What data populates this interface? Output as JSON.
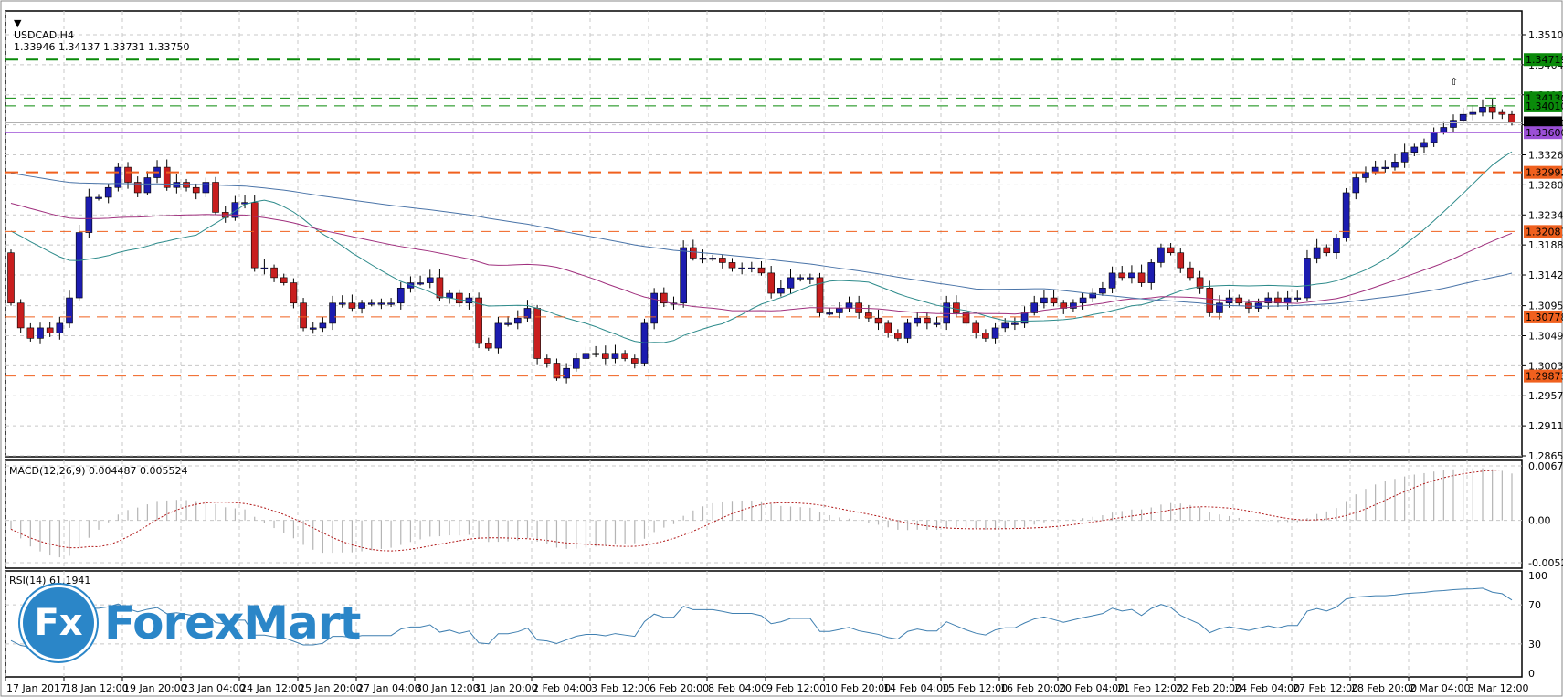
{
  "header": {
    "symbol": "USDCAD,H4",
    "ohlc": "1.33946 1.34137 1.33731 1.33750"
  },
  "colors": {
    "bull": "#1c1cb0",
    "bear": "#c81e1e",
    "green": "#0a8a0a",
    "orange": "#f0601e",
    "purple": "#9b4fd6",
    "current": "#000000",
    "ma_fast": "#2e8b8b",
    "ma_mid": "#a0307e",
    "ma_slow": "#4a74a8",
    "macd_hist": "#b4b4b4",
    "macd_signal": "#b01818",
    "rsi": "#3f7fb0",
    "grid": "#c8c8c8"
  },
  "logo": {
    "mark": "Fx",
    "name": "ForexMart"
  },
  "chart_data": {
    "type": "candlestick",
    "title": "USDCAD,H4",
    "ylim": [
      1.2865,
      1.351
    ],
    "y_ticks": [
      "1.35100",
      "1.34640",
      "1.34180",
      "1.33720",
      "1.33260",
      "1.32800",
      "1.32340",
      "1.31880",
      "1.31420",
      "1.30950",
      "1.30490",
      "1.30030",
      "1.29570",
      "1.29110",
      "1.28650"
    ],
    "x_labels": [
      "17 Jan 2017",
      "18 Jan 12:00",
      "19 Jan 20:00",
      "23 Jan 04:00",
      "24 Jan 12:00",
      "25 Jan 20:00",
      "27 Jan 04:00",
      "30 Jan 12:00",
      "31 Jan 20:00",
      "2 Feb 04:00",
      "3 Feb 12:00",
      "6 Feb 20:00",
      "8 Feb 04:00",
      "9 Feb 12:00",
      "10 Feb 20:00",
      "14 Feb 04:00",
      "15 Feb 12:00",
      "16 Feb 20:00",
      "20 Feb 04:00",
      "21 Feb 12:00",
      "22 Feb 20:00",
      "24 Feb 04:00",
      "27 Feb 12:00",
      "28 Feb 20:00",
      "2 Mar 04:00",
      "3 Mar 12:00"
    ],
    "first_open": 1.3176,
    "closes": [
      1.3099,
      1.3061,
      1.3045,
      1.3061,
      1.3053,
      1.3068,
      1.3107,
      1.3207,
      1.3261,
      1.3261,
      1.3276,
      1.3307,
      1.3284,
      1.3268,
      1.3291,
      1.3307,
      1.3276,
      1.3284,
      1.3276,
      1.3268,
      1.3284,
      1.3238,
      1.323,
      1.3253,
      1.3253,
      1.3153,
      1.3153,
      1.3138,
      1.313,
      1.3099,
      1.3061,
      1.3061,
      1.3068,
      1.3099,
      1.3099,
      1.3091,
      1.3099,
      1.3099,
      1.3099,
      1.3099,
      1.3122,
      1.313,
      1.313,
      1.3138,
      1.3107,
      1.3114,
      1.3099,
      1.3107,
      1.3037,
      1.303,
      1.3068,
      1.3068,
      1.3076,
      1.3091,
      1.3014,
      1.3007,
      1.2984,
      1.2999,
      1.3014,
      1.3022,
      1.3022,
      1.3014,
      1.3022,
      1.3014,
      1.3007,
      1.3068,
      1.3114,
      1.3099,
      1.3099,
      1.3184,
      1.3168,
      1.3168,
      1.3168,
      1.3161,
      1.3153,
      1.3153,
      1.3153,
      1.3145,
      1.3114,
      1.3122,
      1.3138,
      1.3138,
      1.3138,
      1.3084,
      1.3084,
      1.3091,
      1.3099,
      1.3084,
      1.3076,
      1.3068,
      1.3053,
      1.3045,
      1.3068,
      1.3076,
      1.3068,
      1.3068,
      1.3099,
      1.3084,
      1.3068,
      1.3053,
      1.3045,
      1.3061,
      1.3068,
      1.3068,
      1.3084,
      1.3099,
      1.3107,
      1.3099,
      1.3091,
      1.3099,
      1.3107,
      1.3114,
      1.3122,
      1.3145,
      1.3138,
      1.3145,
      1.313,
      1.3161,
      1.3184,
      1.3176,
      1.3153,
      1.3138,
      1.3122,
      1.3084,
      1.3099,
      1.3107,
      1.3099,
      1.3091,
      1.3099,
      1.3107,
      1.3099,
      1.3107,
      1.3107,
      1.3168,
      1.3184,
      1.3176,
      1.3199,
      1.3268,
      1.3291,
      1.3299,
      1.3307,
      1.3307,
      1.3315,
      1.333,
      1.3338,
      1.3345,
      1.3361,
      1.3368,
      1.3379,
      1.3388,
      1.3391,
      1.3399,
      1.3391,
      1.3388,
      1.3375
    ],
    "moving_averages": [
      {
        "name": "fast",
        "period": 20,
        "seed": 1.3215,
        "color_key": "ma_fast"
      },
      {
        "name": "mid",
        "period": 50,
        "seed": 1.3255,
        "color_key": "ma_mid"
      },
      {
        "name": "slow",
        "period": 100,
        "seed": 1.33,
        "color_key": "ma_slow"
      }
    ],
    "levels": [
      {
        "label": "1.34719",
        "value": 1.34719,
        "color_key": "green",
        "style": "dash-thick"
      },
      {
        "label": "1.34130",
        "value": 1.3413,
        "color_key": "green",
        "style": "dash"
      },
      {
        "label": "1.34010",
        "value": 1.3401,
        "color_key": "green",
        "style": "dash"
      },
      {
        "label": "1.33750",
        "value": 1.3375,
        "color_key": "current",
        "style": "solid-grey"
      },
      {
        "label": "1.33600",
        "value": 1.336,
        "color_key": "purple",
        "style": "solid"
      },
      {
        "label": "1.32992",
        "value": 1.32992,
        "color_key": "orange",
        "style": "dash-thick"
      },
      {
        "label": "1.32087",
        "value": 1.32087,
        "color_key": "orange",
        "style": "dash"
      },
      {
        "label": "1.30778",
        "value": 1.30778,
        "color_key": "orange",
        "style": "dash"
      },
      {
        "label": "1.29873",
        "value": 1.29873,
        "color_key": "orange",
        "style": "dash"
      }
    ],
    "macd": {
      "label": "MACD(12,26,9) 0.004487 0.005524",
      "ylim": [
        -0.005265,
        0.006783
      ],
      "ticks": [
        "0.006783",
        "0.00",
        "-0.005265"
      ],
      "fast": 12,
      "slow": 26,
      "signal": 9
    },
    "rsi": {
      "label": "RSI(14) 61.1941",
      "period": 14,
      "ylim": [
        0,
        100
      ],
      "ticks": [
        "100",
        "70",
        "30",
        "0"
      ]
    }
  }
}
